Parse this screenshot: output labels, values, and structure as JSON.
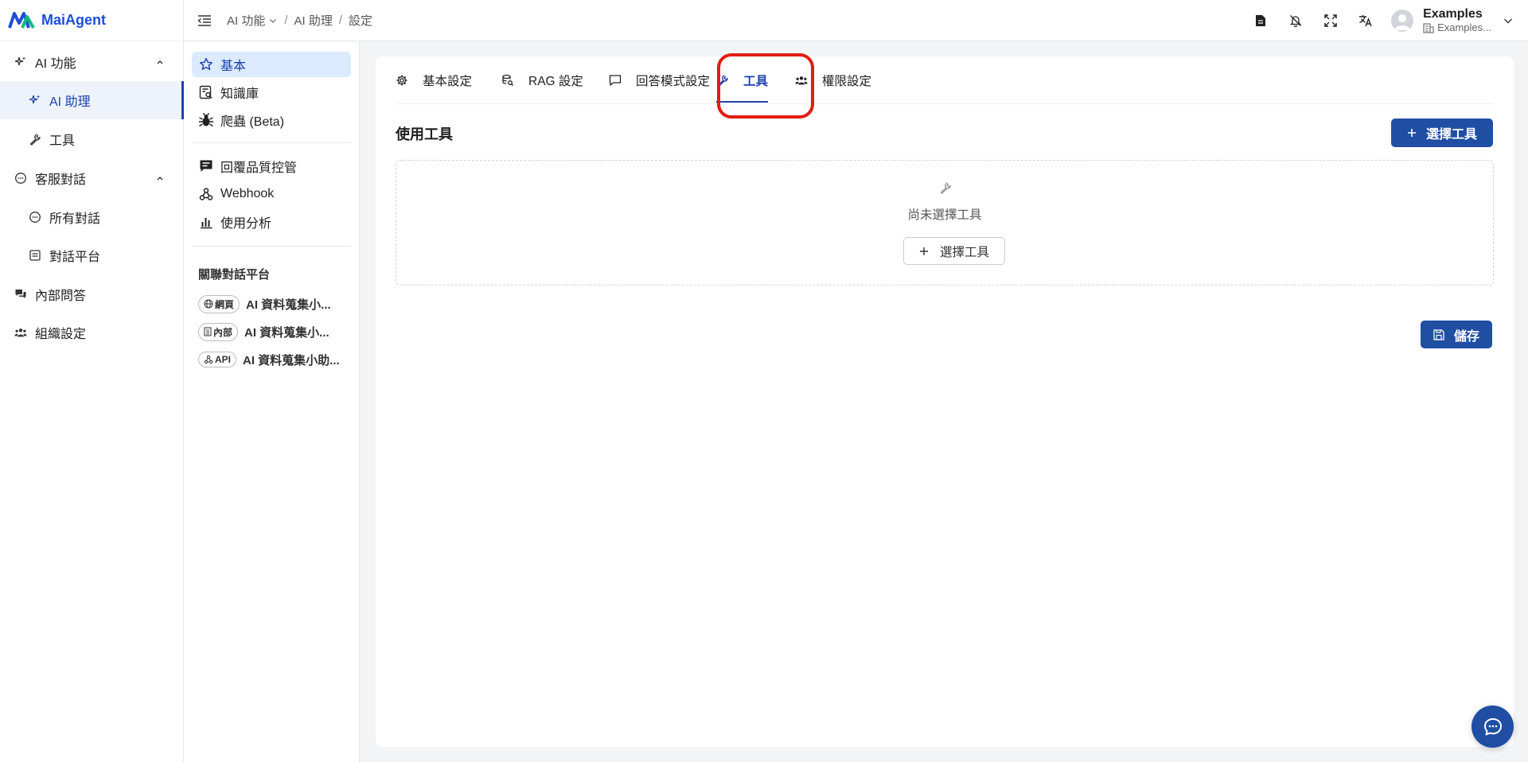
{
  "app": {
    "name": "MaiAgent"
  },
  "sidebar": {
    "items": [
      {
        "label": "AI 功能",
        "icon": "sparkles-icon"
      },
      {
        "label": "AI 助理",
        "icon": "sparkles-icon"
      },
      {
        "label": "工具",
        "icon": "wrench-icon"
      },
      {
        "label": "客服對話",
        "icon": "chat-bubble-icon"
      },
      {
        "label": "所有對話",
        "icon": "chat-bubble-icon"
      },
      {
        "label": "對話平台",
        "icon": "inbox-icon"
      },
      {
        "label": "內部問答",
        "icon": "messages-icon"
      },
      {
        "label": "組織設定",
        "icon": "users-icon"
      }
    ]
  },
  "breadcrumb": {
    "items": [
      "AI 功能",
      "AI 助理",
      "設定"
    ]
  },
  "user": {
    "name": "Examples",
    "org": "Examples..."
  },
  "subnav": {
    "items": [
      {
        "label": "基本",
        "icon": "star-icon"
      },
      {
        "label": "知識庫",
        "icon": "knowledge-base-icon"
      },
      {
        "label": "爬蟲 (Beta)",
        "icon": "bug-icon"
      },
      {
        "label": "回覆品質控管",
        "icon": "feedback-icon"
      },
      {
        "label": "Webhook",
        "icon": "webhook-icon"
      },
      {
        "label": "使用分析",
        "icon": "bar-chart-icon"
      }
    ],
    "platforms_heading": "關聯對話平台",
    "platforms": [
      {
        "tag": "網頁",
        "name": "AI 資料蒐集小..."
      },
      {
        "tag": "內部",
        "name": "AI 資料蒐集小..."
      },
      {
        "tag": "API",
        "name": "AI 資料蒐集小助..."
      }
    ]
  },
  "tabs": [
    {
      "label": "基本設定",
      "icon": "gear-icon"
    },
    {
      "label": "RAG 設定",
      "icon": "database-search-icon"
    },
    {
      "label": "回答模式設定",
      "icon": "message-square-icon"
    },
    {
      "label": "工具",
      "icon": "wrench-icon"
    },
    {
      "label": "權限設定",
      "icon": "users-icon"
    }
  ],
  "tools": {
    "title": "使用工具",
    "select_button": "選擇工具",
    "empty_text": "尚未選擇工具",
    "empty_button": "選擇工具",
    "save_button": "儲存"
  },
  "colors": {
    "primary": "#1f4ea3",
    "highlight": "#e11d10"
  }
}
